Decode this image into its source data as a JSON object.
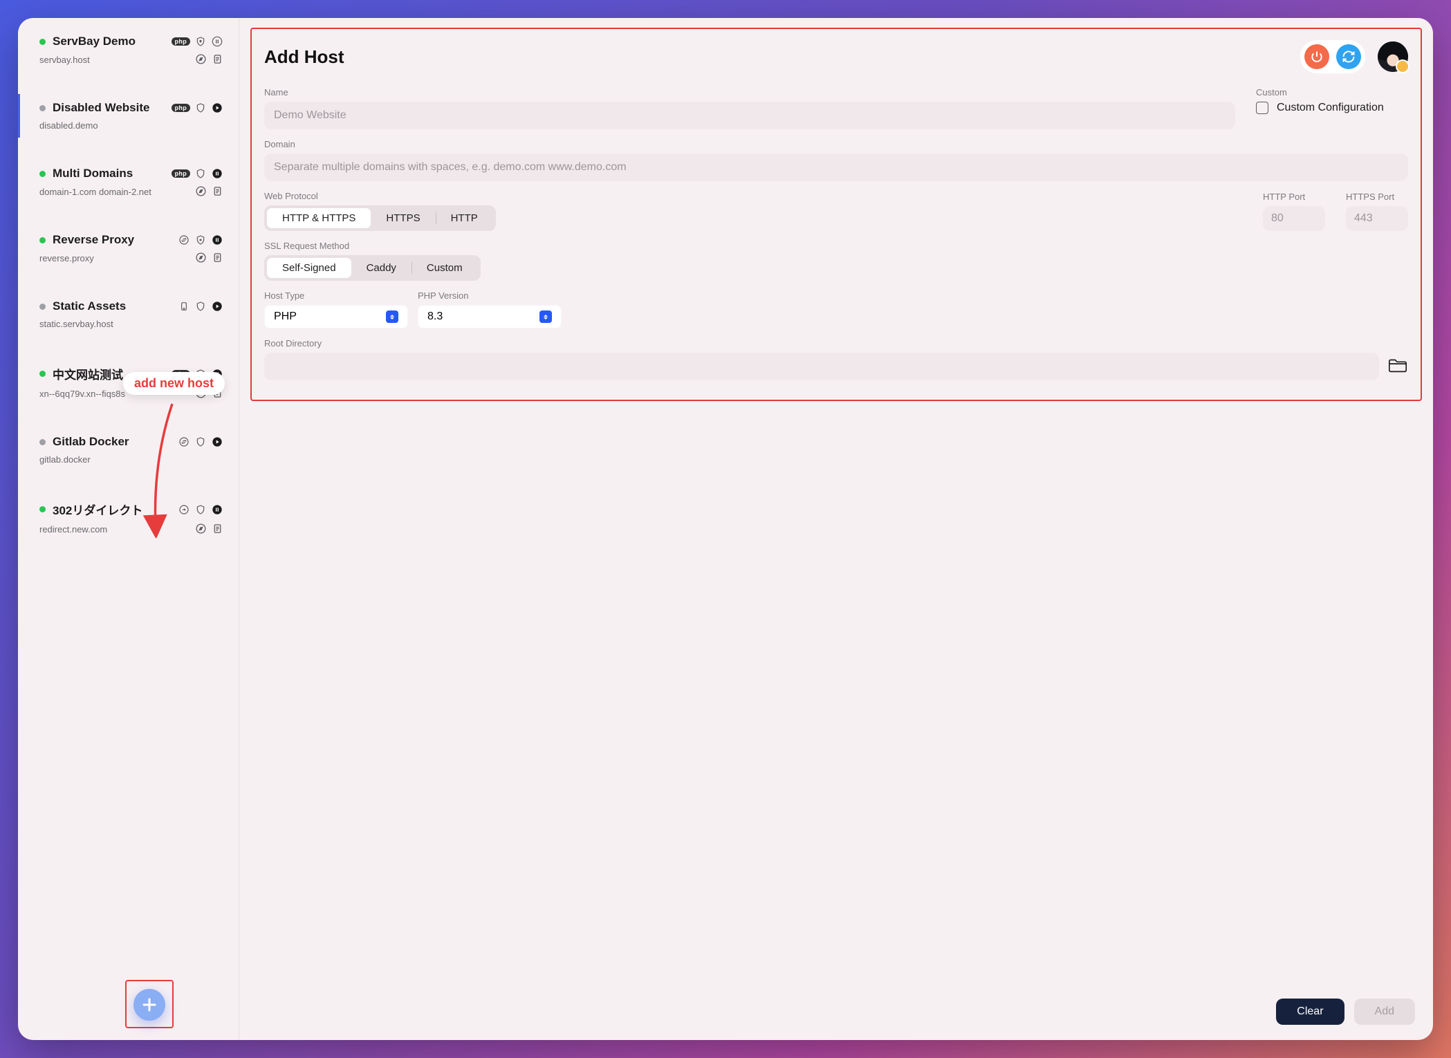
{
  "sidebar": {
    "hosts": [
      {
        "status": "green",
        "name": "ServBay Demo",
        "domain": "servbay.host",
        "badge": "php",
        "icons": [
          "shield-lock",
          "pause"
        ],
        "sub": [
          "compass",
          "note"
        ]
      },
      {
        "status": "gray",
        "name": "Disabled Website",
        "domain": "disabled.demo",
        "badge": "php",
        "icons": [
          "shield",
          "play"
        ],
        "sub": [],
        "selected": true
      },
      {
        "status": "green",
        "name": "Multi Domains",
        "domain": "domain-1.com domain-2.net",
        "badge": "php",
        "icons": [
          "shield",
          "pause-dark"
        ],
        "sub": [
          "compass",
          "note"
        ]
      },
      {
        "status": "green",
        "name": "Reverse Proxy",
        "domain": "reverse.proxy",
        "badge": "swap",
        "icons": [
          "shield-x",
          "pause-dark"
        ],
        "sub": [
          "compass",
          "note"
        ]
      },
      {
        "status": "gray",
        "name": "Static Assets",
        "domain": "static.servbay.host",
        "badge": "device",
        "icons": [
          "shield",
          "play"
        ],
        "sub": []
      },
      {
        "status": "green",
        "name": "中文网站测试",
        "domain": "xn--6qq79v.xn--fiqs8s",
        "badge": "php",
        "icons": [
          "shield",
          "pause-dark"
        ],
        "sub": [
          "compass",
          "note"
        ]
      },
      {
        "status": "gray",
        "name": "Gitlab Docker",
        "domain": "gitlab.docker",
        "badge": "swap",
        "icons": [
          "shield",
          "play"
        ],
        "sub": []
      },
      {
        "status": "green",
        "name": "302リダイレクト",
        "domain": "redirect.new.com",
        "badge": "redirect",
        "icons": [
          "shield",
          "pause-dark"
        ],
        "sub": [
          "compass",
          "note"
        ]
      }
    ]
  },
  "callout": "add new host",
  "main": {
    "title": "Add Host",
    "labels": {
      "name": "Name",
      "domain": "Domain",
      "protocol": "Web Protocol",
      "http_port": "HTTP Port",
      "https_port": "HTTPS Port",
      "ssl": "SSL Request Method",
      "host_type": "Host Type",
      "php_ver": "PHP Version",
      "root": "Root Directory",
      "custom": "Custom",
      "custom_conf": "Custom Configuration"
    },
    "placeholders": {
      "name": "Demo Website",
      "domain": "Separate multiple domains with spaces, e.g. demo.com www.demo.com",
      "http_port": "80",
      "https_port": "443"
    },
    "protocol_options": [
      "HTTP & HTTPS",
      "HTTPS",
      "HTTP"
    ],
    "ssl_options": [
      "Self-Signed",
      "Caddy",
      "Custom"
    ],
    "host_type_value": "PHP",
    "php_version_value": "8.3"
  },
  "footer": {
    "clear": "Clear",
    "add": "Add"
  }
}
